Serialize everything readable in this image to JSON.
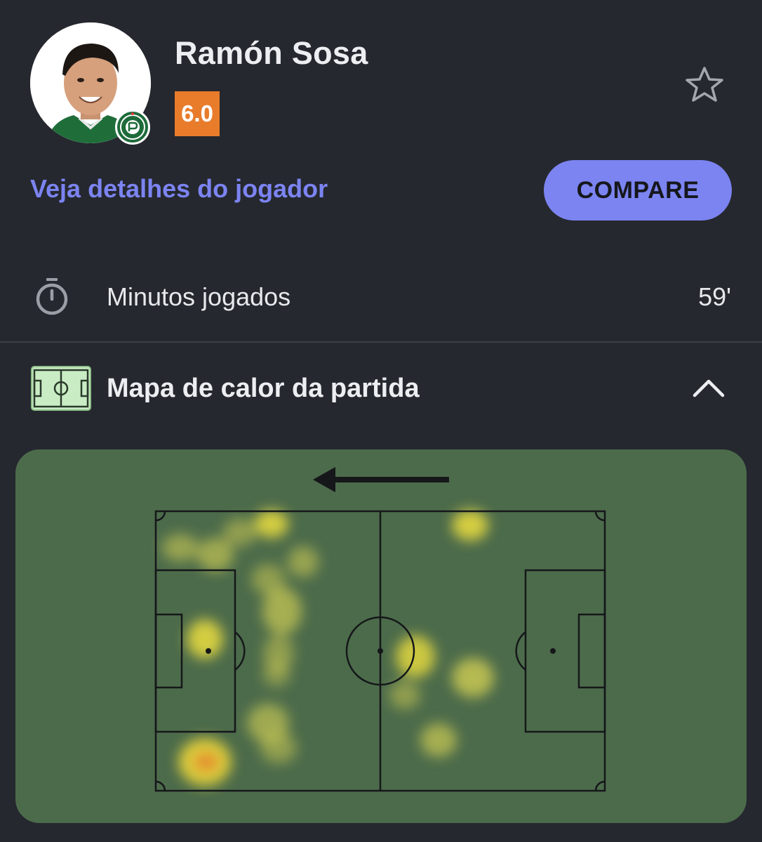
{
  "player": {
    "name": "Ramón Sosa",
    "rating": "6.0",
    "rating_color": "#e87c2b"
  },
  "links": {
    "details": "Veja detalhes do jogador"
  },
  "actions": {
    "compare_label": "COMPARE",
    "favorite_icon": "star-outline-icon"
  },
  "stats": {
    "minutes_label": "Minutos jogados",
    "minutes_value": "59'",
    "minutes_icon": "stopwatch-icon"
  },
  "heatmap_section": {
    "title": "Mapa de calor da partida",
    "icon": "pitch-icon",
    "toggle_icon": "chevron-up-icon",
    "attack_direction": "left",
    "pitch_color": "#4c6b4b"
  },
  "colors": {
    "background": "#25282e",
    "accent": "#7c84f2",
    "text": "#eceef1"
  }
}
